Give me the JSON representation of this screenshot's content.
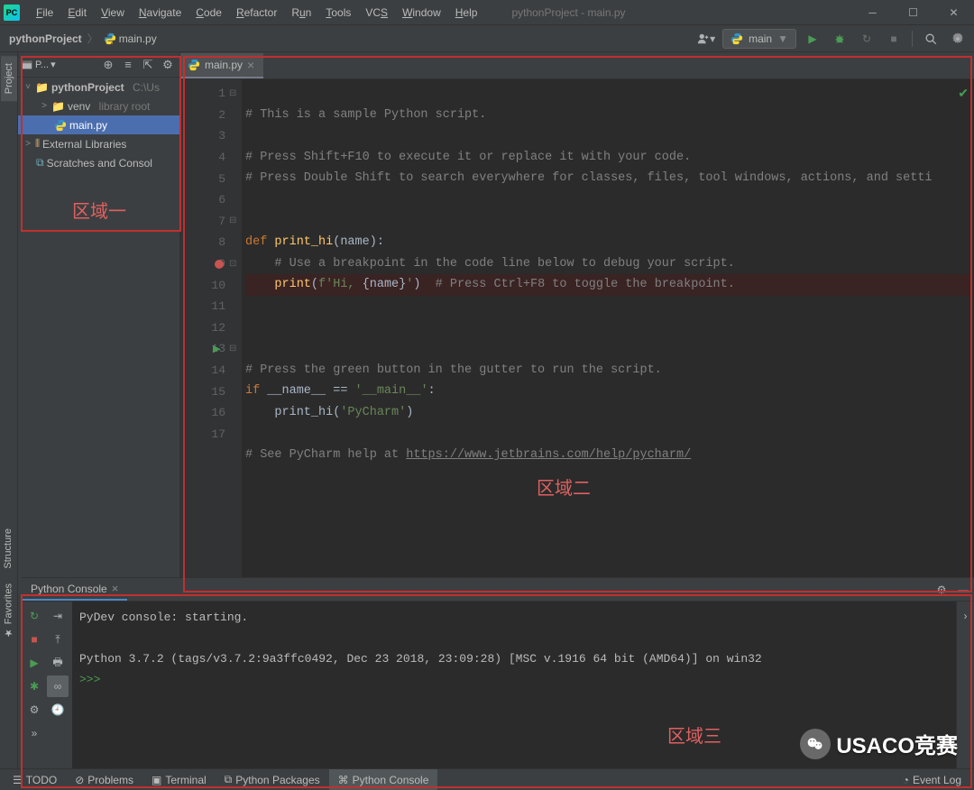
{
  "window": {
    "title": "pythonProject - main.py"
  },
  "menu": {
    "items": [
      "File",
      "Edit",
      "View",
      "Navigate",
      "Code",
      "Refactor",
      "Run",
      "Tools",
      "VCS",
      "Window",
      "Help"
    ]
  },
  "breadcrumbs": {
    "project": "pythonProject",
    "file": "main.py"
  },
  "run_config": {
    "name": "main"
  },
  "project_panel": {
    "title": "P...",
    "tree": {
      "root": "pythonProject",
      "root_path": "C:\\Us",
      "venv": "venv",
      "venv_hint": "library root",
      "file": "main.py",
      "ext_lib": "External Libraries",
      "scratch": "Scratches and Consol"
    }
  },
  "editor": {
    "tab": "main.py",
    "lines": [
      "# This is a sample Python script.",
      "",
      "# Press Shift+F10 to execute it or replace it with your code.",
      "# Press Double Shift to search everywhere for classes, files, tool windows, actions, and setti",
      "",
      "",
      "def print_hi(name):",
      "    # Use a breakpoint in the code line below to debug your script.",
      "    print(f'Hi, {name}')  # Press Ctrl+F8 to toggle the breakpoint.",
      "",
      "",
      "# Press the green button in the gutter to run the script.",
      "if __name__ == '__main__':",
      "    print_hi('PyCharm')",
      "",
      "# See PyCharm help at https://www.jetbrains.com/help/pycharm/",
      ""
    ]
  },
  "console": {
    "tab": "Python Console",
    "line1": "PyDev console: starting.",
    "line2": "Python 3.7.2 (tags/v3.7.2:9a3ffc0492, Dec 23 2018, 23:09:28) [MSC v.1916 64 bit (AMD64)] on win32",
    "prompt": ">>>"
  },
  "bottom_tabs": {
    "todo": "TODO",
    "problems": "Problems",
    "terminal": "Terminal",
    "packages": "Python Packages",
    "pyconsole": "Python Console",
    "eventlog": "Event Log"
  },
  "side_tabs": {
    "project": "Project",
    "structure": "Structure",
    "favorites": "Favorites"
  },
  "regions": {
    "r1": "区域一",
    "r2": "区域二",
    "r3": "区域三"
  },
  "watermark": "USACO竞赛"
}
